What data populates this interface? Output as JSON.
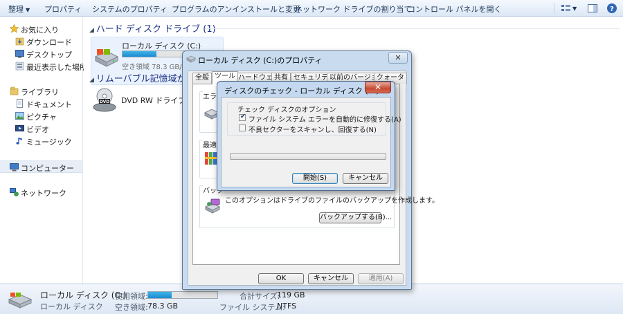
{
  "toolbar": {
    "organize": "整理",
    "properties": "プロパティ",
    "system_properties": "システムのプロパティ",
    "uninstall": "プログラムのアンインストールと変更",
    "map_drive": "ネットワーク ドライブの割り当て",
    "control_panel": "コントロール パネルを開く"
  },
  "sidebar": {
    "favorites": "お気に入り",
    "downloads": "ダウンロード",
    "desktop": "デスクトップ",
    "recent": "最近表示した場所",
    "libraries": "ライブラリ",
    "documents": "ドキュメント",
    "pictures": "ピクチャ",
    "videos": "ビデオ",
    "music": "ミュージック",
    "computer": "コンピューター",
    "network": "ネットワーク"
  },
  "main": {
    "hdd_group": "ハード ディスク ドライブ (1)",
    "removable_group": "リムーバブル記憶域があ",
    "local_disk_name": "ローカル ディスク (C:)",
    "local_disk_free": "空き領域 78.3 GB/11",
    "local_disk_usage": 0.34,
    "dvd_name": "DVD RW ドライブ (D"
  },
  "statusbar": {
    "name": "ローカル ディスク (C:)",
    "type": "ローカル ディスク",
    "used_label": "使用領域:",
    "free_label": "空き領域:",
    "free_value": "78.3 GB",
    "total_label": "合計サイズ:",
    "total_value": "119 GB",
    "fs_label": "ファイル システム:",
    "fs_value": "NTFS",
    "usage": 0.34
  },
  "properties_dialog": {
    "title": "ローカル ディスク (C:)のプロパティ",
    "tabs": [
      "全般",
      "ツール",
      "ハードウェア",
      "共有",
      "セキュリティ",
      "以前のバージョン",
      "クォータ"
    ],
    "error_check_title": "エラー",
    "defrag_title": "最適",
    "backup_title": "バック",
    "backup_desc": "このオプションはドライブのファイルのバックアップを作成します。",
    "backup_button": "バックアップする(B)...",
    "ok": "OK",
    "cancel": "キャンセル",
    "apply": "適用(A)"
  },
  "check_dialog": {
    "title": "ディスクのチェック - ローカル ディスク (C:)",
    "group_title": "チェック ディスクのオプション",
    "option1": "ファイル システム エラーを自動的に修復する(A)",
    "option1_checked": true,
    "option2": "不良セクターをスキャンし、回復する(N)",
    "option2_checked": false,
    "start": "開始(S)",
    "cancel": "キャンセル",
    "progress": 0
  },
  "colors": {
    "link_blue": "#1e3287",
    "accent": "#1a8ccf",
    "close_red": "#c74a32"
  }
}
